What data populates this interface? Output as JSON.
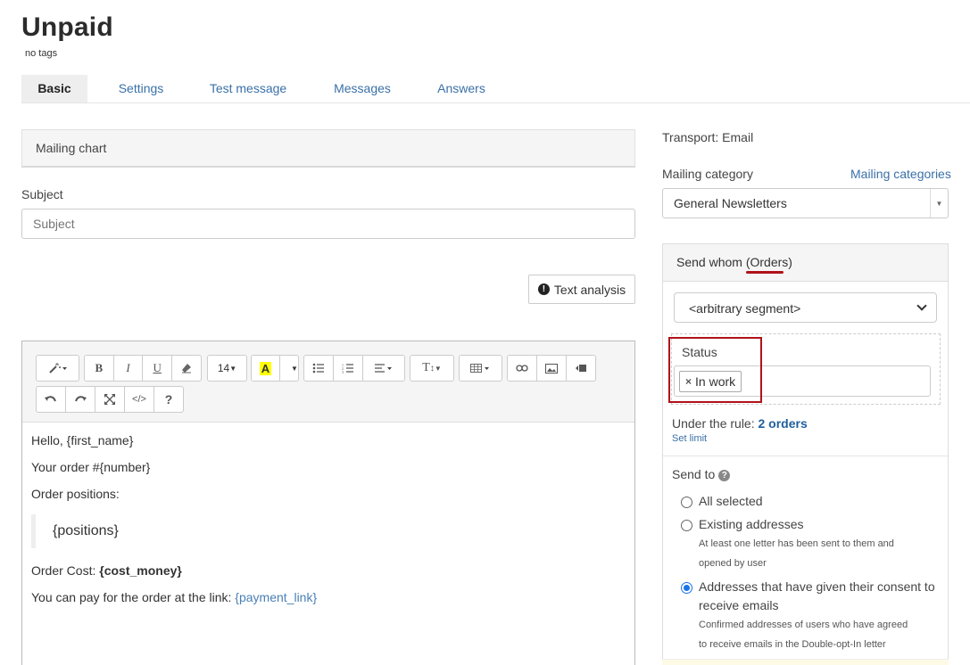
{
  "page": {
    "title": "Unpaid",
    "tags": "no tags"
  },
  "tabs": [
    {
      "label": "Basic",
      "active": true
    },
    {
      "label": "Settings",
      "active": false
    },
    {
      "label": "Test message",
      "active": false
    },
    {
      "label": "Messages",
      "active": false
    },
    {
      "label": "Answers",
      "active": false
    }
  ],
  "mailing_chart": {
    "label": "Mailing chart"
  },
  "subject": {
    "label": "Subject",
    "placeholder": "Subject",
    "value": ""
  },
  "text_analysis": {
    "label": "Text analysis",
    "icon": "exclamation-circle-icon"
  },
  "toolbar": {
    "font_size": "14",
    "color_letter": "A",
    "highlight_color": "#ffff00"
  },
  "editor_content": {
    "line1": "Hello, {first_name}",
    "line2": "Your order #{number}",
    "line3": "Order positions:",
    "quote": "{positions}",
    "cost_label": "Order Cost: ",
    "cost_value": "{cost_money}",
    "pay_label": "You can pay for the order at the link: ",
    "pay_link": "{payment_link}"
  },
  "transport": {
    "text": "Transport: Email"
  },
  "mailing_category": {
    "label": "Mailing category",
    "link": "Mailing categories",
    "selected": "General Newsletters"
  },
  "send_whom": {
    "label_prefix": "Send whom (",
    "label_link": "Orders",
    "label_suffix": ")",
    "segment_selected": "<arbitrary segment>",
    "status_label": "Status",
    "status_chip": "In work",
    "rule_label": "Under the rule: ",
    "rule_count": "2 orders",
    "set_limit": "Set limit"
  },
  "send_to": {
    "label": "Send to",
    "options": [
      {
        "label": "All selected",
        "selected": false,
        "description": ""
      },
      {
        "label": "Existing addresses",
        "selected": false,
        "description_line1": "At least one letter has been sent to them and",
        "description_line2": "opened by user"
      },
      {
        "label_line1": "Addresses that have given their consent to",
        "label_line2": "receive emails",
        "selected": true,
        "description_line1": "Confirmed addresses of users who have agreed",
        "description_line2": "to receive emails in the Double-opt-In letter"
      }
    ]
  },
  "colors": {
    "link": "#3a70a8",
    "highlight_annotation": "#b0121a",
    "radio_selected": "#1a73e8"
  }
}
